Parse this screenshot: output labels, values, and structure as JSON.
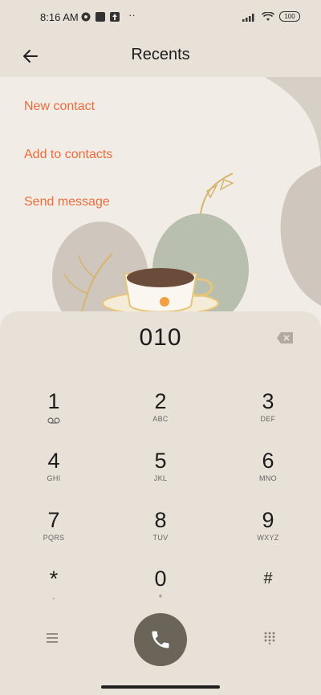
{
  "status_bar": {
    "time": "8:16 AM",
    "battery": "100"
  },
  "header": {
    "title": "Recents"
  },
  "menu": [
    {
      "label": "New contact"
    },
    {
      "label": "Add to contacts"
    },
    {
      "label": "Send message"
    }
  ],
  "dialer": {
    "number": "010",
    "keys": [
      {
        "digit": "1",
        "letters": ""
      },
      {
        "digit": "2",
        "letters": "ABC"
      },
      {
        "digit": "3",
        "letters": "DEF"
      },
      {
        "digit": "4",
        "letters": "GHI"
      },
      {
        "digit": "5",
        "letters": "JKL"
      },
      {
        "digit": "6",
        "letters": "MNO"
      },
      {
        "digit": "7",
        "letters": "PQRS"
      },
      {
        "digit": "8",
        "letters": "TUV"
      },
      {
        "digit": "9",
        "letters": "WXYZ"
      },
      {
        "digit": "*",
        "letters": ","
      },
      {
        "digit": "0",
        "letters": "+"
      },
      {
        "digit": "#",
        "letters": ""
      }
    ]
  },
  "colors": {
    "accent": "#ef6a3b",
    "call_button": "#6b6459",
    "background": "#e7e1d8"
  },
  "icons": [
    "back-arrow-icon",
    "backspace-icon",
    "voicemail-icon",
    "phone-icon",
    "menu-icon",
    "dialpad-icon"
  ]
}
